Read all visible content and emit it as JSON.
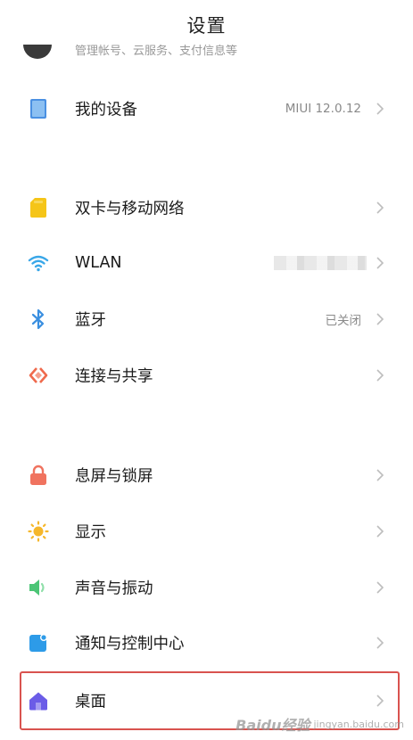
{
  "header": {
    "title": "设置"
  },
  "account": {
    "subtitle": "管理帐号、云服务、支付信息等"
  },
  "items": [
    {
      "key": "my-device",
      "label": "我的设备",
      "value": "MIUI 12.0.12",
      "icon": "device-icon",
      "icon_color": "#4a90e2"
    },
    {
      "key": "dual-sim",
      "label": "双卡与移动网络",
      "value": "",
      "icon": "sim-card-icon",
      "icon_color": "#f5c518"
    },
    {
      "key": "wlan",
      "label": "WLAN",
      "value": "",
      "icon": "wifi-icon",
      "icon_color": "#3aa7e8"
    },
    {
      "key": "bluetooth",
      "label": "蓝牙",
      "value": "已关闭",
      "icon": "bluetooth-icon",
      "icon_color": "#3a8fe0"
    },
    {
      "key": "connection-sharing",
      "label": "连接与共享",
      "value": "",
      "icon": "share-icon",
      "icon_color": "#ef6a4d"
    },
    {
      "key": "lock-screen",
      "label": "息屏与锁屏",
      "value": "",
      "icon": "lock-icon",
      "icon_color": "#f0735f"
    },
    {
      "key": "display",
      "label": "显示",
      "value": "",
      "icon": "sun-icon",
      "icon_color": "#f5b72b"
    },
    {
      "key": "sound-vibration",
      "label": "声音与振动",
      "value": "",
      "icon": "speaker-icon",
      "icon_color": "#4cc576"
    },
    {
      "key": "notifications",
      "label": "通知与控制中心",
      "value": "",
      "icon": "notification-icon",
      "icon_color": "#2d9be8"
    },
    {
      "key": "home-screen",
      "label": "桌面",
      "value": "",
      "icon": "home-icon",
      "icon_color": "#6b5ce7"
    }
  ],
  "watermark": {
    "brand": "Baidu经验",
    "sub": "jingyan.baidu.com"
  },
  "colors": {
    "highlight": "#d9534f",
    "chevron": "#bdbdbd"
  }
}
